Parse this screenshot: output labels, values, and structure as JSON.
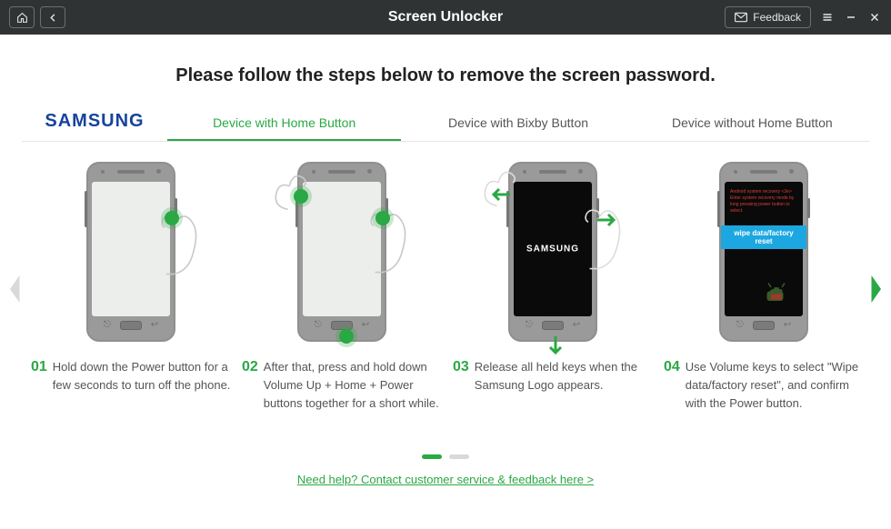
{
  "titlebar": {
    "title": "Screen Unlocker",
    "feedback_label": "Feedback"
  },
  "heading": "Please follow the steps below to remove the screen password.",
  "brand": "SAMSUNG",
  "tabs": [
    {
      "label": "Device with Home Button",
      "active": true
    },
    {
      "label": "Device with Bixby Button",
      "active": false
    },
    {
      "label": "Device without Home Button",
      "active": false
    }
  ],
  "steps": [
    {
      "num": "01",
      "desc": "Hold down the Power button for a few seconds to turn off the phone."
    },
    {
      "num": "02",
      "desc": "After that, press and hold down Volume Up + Home + Power buttons together for a short while."
    },
    {
      "num": "03",
      "desc": "Release all held keys when the Samsung Logo appears."
    },
    {
      "num": "04",
      "desc": "Use Volume keys to select \"Wipe data/factory reset\", and confirm with the Power button."
    }
  ],
  "phone3": {
    "logo": "SAMSUNG"
  },
  "phone4": {
    "recovery_lines": "Android system recovery <3e>\n\nEnter system recovery mode by long pressing\npower button to select.",
    "wipe_label": "wipe data/factory reset"
  },
  "pager": {
    "total": 2,
    "active_index": 0
  },
  "help_link_label": "Need help? Contact customer service & feedback here >"
}
